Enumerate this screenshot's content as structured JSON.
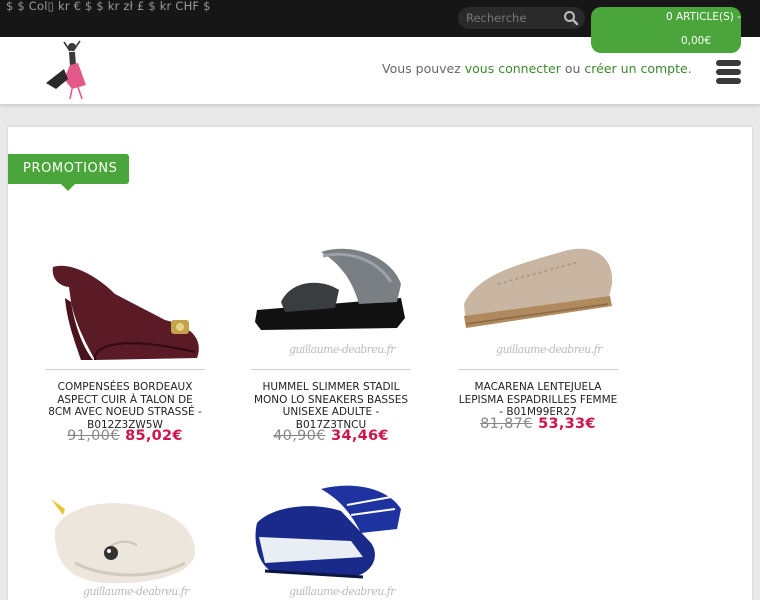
{
  "topbar": {
    "currencies": "$ $ Col▯ kr € $ $ kr zł £ $ kr CHF $",
    "search_placeholder": "Recherche",
    "cart_line1": "0 ARTICLE(S) -",
    "cart_line2": "0,00€"
  },
  "header": {
    "account_prefix": "Vous pouvez ",
    "login_link": "vous connecter",
    "account_or": " ou ",
    "register_link": "créer un compte",
    "account_suffix": "."
  },
  "section": {
    "title": "PROMOTIONS"
  },
  "products": [
    {
      "title": "COMPENSÉES BORDEAUX ASPECT CUIR À TALON DE 8CM AVEC NOEUD STRASSÉ - B012Z3ZW5W",
      "old_price": "91,00€",
      "new_price": "85,02€",
      "watermark": ""
    },
    {
      "title": "HUMMEL SLIMMER STADIL MONO LO SNEAKERS BASSES UNISEXE ADULTE - B017Z3TNCU",
      "old_price": "40,90€",
      "new_price": "34,46€",
      "watermark": "guillaume-deabreu.fr"
    },
    {
      "title": "MACARENA LENTEJUELA LEPISMA ESPADRILLES FEMME - B01M99ER27",
      "old_price": "81,87€",
      "new_price": "53,33€",
      "watermark": "guillaume-deabreu.fr"
    },
    {
      "title": "",
      "old_price": "",
      "new_price": "",
      "watermark": "guillaume-deabreu.fr"
    },
    {
      "title": "",
      "old_price": "",
      "new_price": "",
      "watermark": "guillaume-deabreu.fr"
    }
  ],
  "colors": {
    "accent_green": "#4aa63b",
    "price_red": "#d0134c",
    "topbar": "#161616"
  },
  "icons": [
    "search-icon",
    "menu-icon",
    "logo-dancer-icon"
  ]
}
